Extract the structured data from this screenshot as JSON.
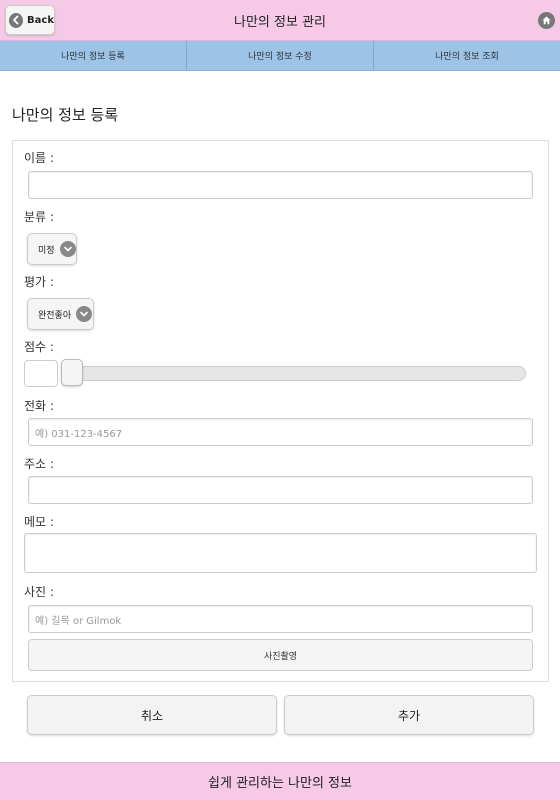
{
  "header": {
    "back_label": "Back",
    "title": "나만의 정보 관리",
    "back_icon": "left-arrow-circle-icon",
    "home_icon": "home-icon"
  },
  "nav": {
    "tabs": [
      {
        "label": "나만의 정보 등록"
      },
      {
        "label": "나만의 정보 수정"
      },
      {
        "label": "나만의 정보 조회"
      }
    ]
  },
  "page": {
    "title": "나만의 정보 등록"
  },
  "form": {
    "name_label": "이름 :",
    "name_value": "",
    "category_label": "분류 :",
    "category_value": "미정",
    "rating_label": "평가 :",
    "rating_value": "완전좋아",
    "score_label": "점수 :",
    "score_value": "",
    "score_level": 0,
    "phone_label": "전화 :",
    "phone_placeholder": "예) 031-123-4567",
    "address_label": "주소 :",
    "address_value": "",
    "memo_label": "메모 :",
    "memo_value": "",
    "photo_label": "사진 :",
    "photo_placeholder": "예) 길목 or Gilmok",
    "photo_button": "사진촬영"
  },
  "actions": {
    "cancel": "취소",
    "add": "추가"
  },
  "footer": {
    "text": "쉽게 관리하는 나만의 정보"
  },
  "colors": {
    "header_bg": "#f6c9e6",
    "nav_bg": "#9dc3e6",
    "footer_bg": "#f6c9e6"
  }
}
